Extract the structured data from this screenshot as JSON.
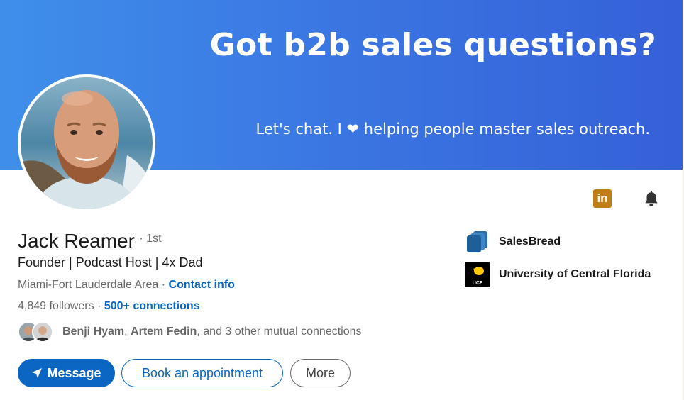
{
  "banner": {
    "headline": "Got b2b sales questions?",
    "subline": "Let's chat. I ❤ helping people master sales outreach."
  },
  "profile": {
    "name": "Jack Reamer",
    "degree": "· 1st",
    "headline": "Founder | Podcast Host | 4x Dad",
    "location": "Miami-Fort Lauderdale Area",
    "separator": " · ",
    "contact_info": "Contact info",
    "followers": "4,849 followers",
    "connections_separator": " · ",
    "connections": "500+ connections"
  },
  "mutual": {
    "person1": "Benji Hyam",
    "comma": ", ",
    "person2": "Artem Fedin",
    "rest": ", and 3 other mutual connections"
  },
  "actions": {
    "message": "Message",
    "book": "Book an appointment",
    "more": "More"
  },
  "companies": [
    {
      "label": "SalesBread",
      "icon": "salesbread-logo"
    },
    {
      "label": "University of Central Florida",
      "icon": "ucf-logo",
      "logo_text": "UCF"
    }
  ],
  "icons": {
    "linkedin_badge": "in",
    "linkedin_color": "#c37d16",
    "bell": "bell-icon"
  },
  "colors": {
    "link": "#0a66c2",
    "banner": "#3b78e3"
  }
}
